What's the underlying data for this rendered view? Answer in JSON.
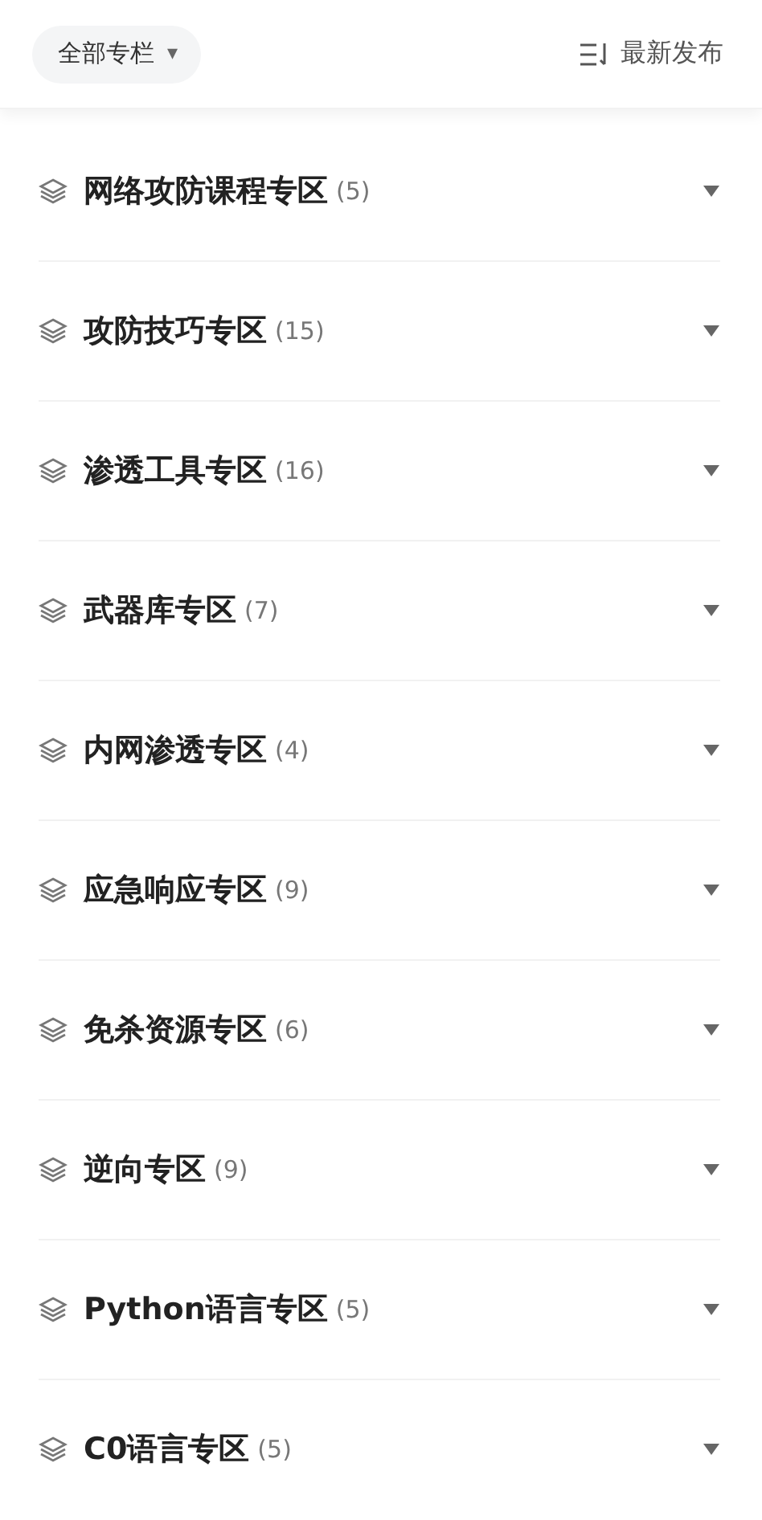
{
  "filter": {
    "label": "全部专栏",
    "caret": "▾"
  },
  "sort": {
    "label": "最新发布"
  },
  "sections": [
    {
      "title": "网络攻防课程专区",
      "count": "(5)",
      "expanded": false
    },
    {
      "title": "攻防技巧专区",
      "count": "(15)",
      "expanded": false
    },
    {
      "title": "渗透工具专区",
      "count": "(16)",
      "expanded": false
    },
    {
      "title": "武器库专区",
      "count": "(7)",
      "expanded": false
    },
    {
      "title": "内网渗透专区",
      "count": "(4)",
      "expanded": false
    },
    {
      "title": "应急响应专区",
      "count": "(9)",
      "expanded": false
    },
    {
      "title": "免杀资源专区",
      "count": "(6)",
      "expanded": false
    },
    {
      "title": "逆向专区",
      "count": "(9)",
      "expanded": false
    },
    {
      "title": "Python语言专区",
      "count": "(5)",
      "expanded": false
    },
    {
      "title": "C0语言专区",
      "count": "(5)",
      "expanded": false
    }
  ]
}
